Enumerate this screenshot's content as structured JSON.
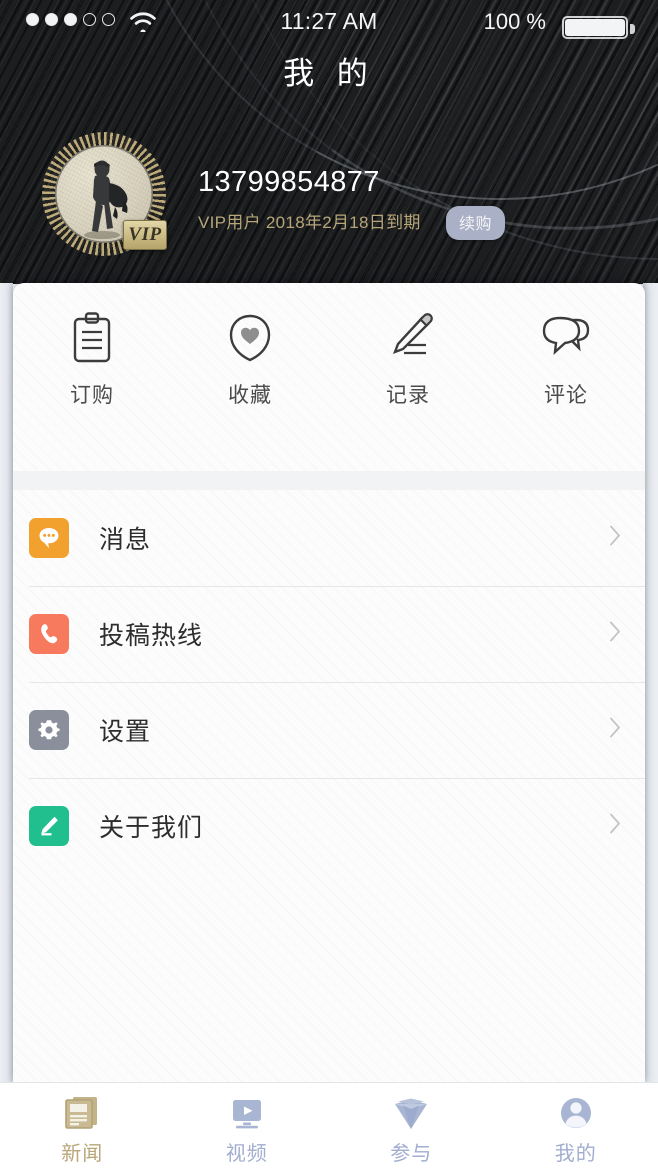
{
  "status_bar": {
    "signal_total": 5,
    "signal_filled": 3,
    "wifi_icon": "wifi-icon",
    "time": "11:27 AM",
    "battery_percent": "100 %",
    "battery_icon": "battery-full-icon"
  },
  "nav": {
    "title": "我 的"
  },
  "profile": {
    "avatar_icon": "avatar-photo",
    "vip_badge_label": "VIP",
    "phone": "13799854877",
    "vip_line": "VIP用户 2018年2月18日到期",
    "renew_label": "续购",
    "phone_color": "#ffffff",
    "vip_text_color": "#b6a678",
    "renew_bg_color": "#aab0c5",
    "header_bg_color": "#17191c"
  },
  "quick_actions": [
    {
      "label": "订购",
      "icon": "clipboard-icon"
    },
    {
      "label": "收藏",
      "icon": "heart-circle-icon"
    },
    {
      "label": "记录",
      "icon": "pencil-icon"
    },
    {
      "label": "评论",
      "icon": "speech-bubbles-icon"
    }
  ],
  "menu_items": [
    {
      "label": "消息",
      "icon": "chat-bubble-icon",
      "icon_color": "#f2a02e",
      "chevron": "chevron-right-icon"
    },
    {
      "label": "投稿热线",
      "icon": "phone-icon",
      "icon_color": "#f87a5e",
      "chevron": "chevron-right-icon"
    },
    {
      "label": "设置",
      "icon": "gear-icon",
      "icon_color": "#8b8f9c",
      "chevron": "chevron-right-icon"
    },
    {
      "label": "关于我们",
      "icon": "pencil-square-icon",
      "icon_color": "#22bf8e",
      "chevron": "chevron-right-icon"
    }
  ],
  "tabs": [
    {
      "label": "新闻",
      "icon": "newspaper-icon",
      "color": "#b8a678",
      "active": true
    },
    {
      "label": "视频",
      "icon": "video-play-icon",
      "color": "#a8b6d4",
      "active": false
    },
    {
      "label": "参与",
      "icon": "diamond-icon",
      "color": "#a8b6d4",
      "active": false
    },
    {
      "label": "我的",
      "icon": "person-icon",
      "color": "#a8b6d4",
      "active": false
    }
  ]
}
